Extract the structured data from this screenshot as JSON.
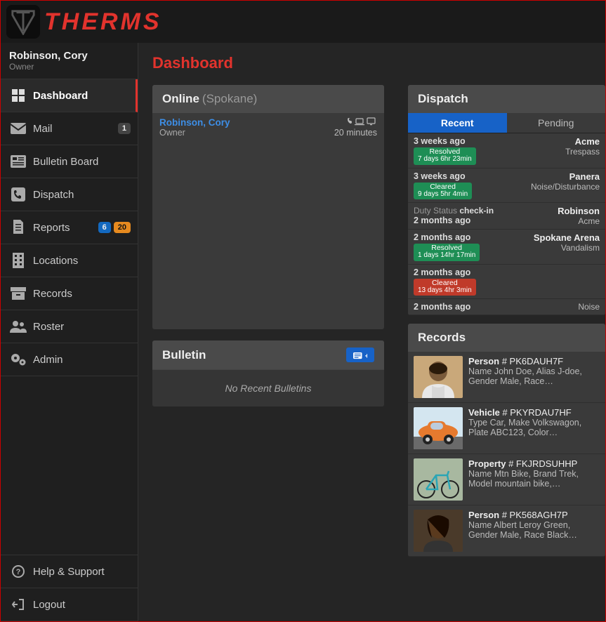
{
  "brand": "THERMS",
  "user": {
    "name": "Robinson, Cory",
    "role": "Owner"
  },
  "nav": {
    "dashboard": "Dashboard",
    "mail": "Mail",
    "mail_badge": "1",
    "bulletin": "Bulletin Board",
    "dispatch": "Dispatch",
    "reports": "Reports",
    "reports_badge_blue": "6",
    "reports_badge_orange": "20",
    "locations": "Locations",
    "records": "Records",
    "roster": "Roster",
    "admin": "Admin",
    "help": "Help & Support",
    "logout": "Logout"
  },
  "page_title": "Dashboard",
  "online": {
    "heading": "Online",
    "region": "(Spokane)",
    "user_name": "Robinson, Cory",
    "user_role": "Owner",
    "time": "20 minutes"
  },
  "bulletin": {
    "heading": "Bulletin",
    "empty": "No Recent Bulletins"
  },
  "dispatch": {
    "heading": "Dispatch",
    "tab_recent": "Recent",
    "tab_pending": "Pending",
    "rows": [
      {
        "ago": "3 weeks ago",
        "pill_top": "Resolved",
        "pill_bot": "7 days 6hr 23min",
        "pill_color": "green",
        "loc": "Acme",
        "ctype": "Trespass"
      },
      {
        "ago": "3 weeks ago",
        "pill_top": "Cleared",
        "pill_bot": "9 days 5hr 4min",
        "pill_color": "green",
        "loc": "Panera",
        "ctype": "Noise/Disturbance"
      },
      {
        "checkin_label": "Duty Status",
        "checkin_bold": "check-in",
        "ago": "2 months ago",
        "loc": "Robinson",
        "ctype": "Acme"
      },
      {
        "ago": "2 months ago",
        "pill_top": "Resolved",
        "pill_bot": "1 days 14hr 17min",
        "pill_color": "green",
        "loc": "Spokane Arena",
        "ctype": "Vandalism"
      },
      {
        "ago": "2 months ago",
        "pill_top": "Cleared",
        "pill_bot": "13 days 4hr 3min",
        "pill_color": "red",
        "loc": "",
        "ctype": ""
      },
      {
        "ago": "2 months ago",
        "pill_top": "",
        "pill_bot": "",
        "pill_color": "",
        "loc": "",
        "ctype": "Noise"
      }
    ]
  },
  "records": {
    "heading": "Records",
    "rows": [
      {
        "type": "Person",
        "id": "# PK6DAUH7F",
        "desc": "Name John Doe, Alias J-doe, Gender Male, Race…",
        "thumb": "person1"
      },
      {
        "type": "Vehicle",
        "id": "# PKYRDAU7HF",
        "desc": "Type Car, Make Volkswagon, Plate ABC123, Color…",
        "thumb": "car"
      },
      {
        "type": "Property",
        "id": "# FKJRDSUHHP",
        "desc": "Name Mtn Bike, Brand Trek, Model mountain bike,…",
        "thumb": "bike"
      },
      {
        "type": "Person",
        "id": "# PK568AGH7P",
        "desc": "Name Albert Leroy Green, Gender Male, Race Black…",
        "thumb": "person2"
      }
    ]
  }
}
